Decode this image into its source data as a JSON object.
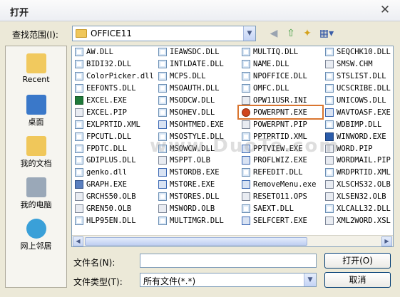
{
  "window": {
    "title": "打开",
    "close_glyph": "✕"
  },
  "lookin": {
    "label": "查找范围(I):",
    "value": "OFFICE11"
  },
  "places": [
    {
      "label": "Recent"
    },
    {
      "label": "桌面"
    },
    {
      "label": "我的文档"
    },
    {
      "label": "我的电脑"
    },
    {
      "label": "网上邻居"
    }
  ],
  "files": {
    "col1": [
      {
        "name": "AW.DLL",
        "icon": "dll"
      },
      {
        "name": "BIDI32.DLL",
        "icon": "dll"
      },
      {
        "name": "ColorPicker.dll",
        "icon": "dll"
      },
      {
        "name": "EEFONTS.DLL",
        "icon": "dll"
      },
      {
        "name": "EXCEL.EXE",
        "icon": "xls"
      },
      {
        "name": "EXCEL.PIP",
        "icon": "olb"
      },
      {
        "name": "EXLPRTID.XML",
        "icon": "dll"
      },
      {
        "name": "FPCUTL.DLL",
        "icon": "dll"
      },
      {
        "name": "FPDTC.DLL",
        "icon": "dll"
      },
      {
        "name": "GDIPLUS.DLL",
        "icon": "dll"
      },
      {
        "name": "genko.dll",
        "icon": "dll"
      },
      {
        "name": "GRAPH.EXE",
        "icon": "app"
      },
      {
        "name": "GRCHS50.OLB",
        "icon": "olb"
      },
      {
        "name": "GREN50.OLB",
        "icon": "olb"
      },
      {
        "name": "HLP95EN.DLL",
        "icon": "dll"
      }
    ],
    "col2": [
      {
        "name": "IEAWSDC.DLL",
        "icon": "dll"
      },
      {
        "name": "INTLDATE.DLL",
        "icon": "dll"
      },
      {
        "name": "MCPS.DLL",
        "icon": "dll"
      },
      {
        "name": "MSOAUTH.DLL",
        "icon": "dll"
      },
      {
        "name": "MSODCW.DLL",
        "icon": "dll"
      },
      {
        "name": "MSOHEV.DLL",
        "icon": "dll"
      },
      {
        "name": "MSOHTMED.EXE",
        "icon": "exe"
      },
      {
        "name": "MSOSTYLE.DLL",
        "icon": "dll"
      },
      {
        "name": "MSOWCW.DLL",
        "icon": "dll"
      },
      {
        "name": "MSPPT.OLB",
        "icon": "olb"
      },
      {
        "name": "MSTORDB.EXE",
        "icon": "exe"
      },
      {
        "name": "MSTORE.EXE",
        "icon": "exe"
      },
      {
        "name": "MSTORES.DLL",
        "icon": "dll"
      },
      {
        "name": "MSWORD.OLB",
        "icon": "olb"
      },
      {
        "name": "MULTIMGR.DLL",
        "icon": "dll"
      }
    ],
    "col3": [
      {
        "name": "MULTIQ.DLL",
        "icon": "dll"
      },
      {
        "name": "NAME.DLL",
        "icon": "dll"
      },
      {
        "name": "NPOFFICE.DLL",
        "icon": "dll"
      },
      {
        "name": "OMFC.DLL",
        "icon": "dll"
      },
      {
        "name": "OPW11USR.INI",
        "icon": "olb"
      },
      {
        "name": "POWERPNT.EXE",
        "icon": "ppt",
        "selected": true
      },
      {
        "name": "POWERPNT.PIP",
        "icon": "olb"
      },
      {
        "name": "PPTPRTID.XML",
        "icon": "dll"
      },
      {
        "name": "PPTVIEW.EXE",
        "icon": "exe"
      },
      {
        "name": "PROFLWIZ.EXE",
        "icon": "exe"
      },
      {
        "name": "REFEDIT.DLL",
        "icon": "dll"
      },
      {
        "name": "RemoveMenu.exe",
        "icon": "exe"
      },
      {
        "name": "RESETO11.OPS",
        "icon": "olb"
      },
      {
        "name": "SAEXT.DLL",
        "icon": "dll"
      },
      {
        "name": "SELFCERT.EXE",
        "icon": "exe"
      }
    ],
    "col4": [
      {
        "name": "SEQCHK10.DLL",
        "icon": "dll"
      },
      {
        "name": "SMSW.CHM",
        "icon": "olb"
      },
      {
        "name": "STSLIST.DLL",
        "icon": "dll"
      },
      {
        "name": "UCSCRIBE.DLL",
        "icon": "dll"
      },
      {
        "name": "UNICOWS.DLL",
        "icon": "dll"
      },
      {
        "name": "WAVTOASF.EXE",
        "icon": "exe"
      },
      {
        "name": "WDBIMP.DLL",
        "icon": "dll"
      },
      {
        "name": "WINWORD.EXE",
        "icon": "doc"
      },
      {
        "name": "WORD.PIP",
        "icon": "olb"
      },
      {
        "name": "WORDMAIL.PIP",
        "icon": "olb"
      },
      {
        "name": "WRDPRTID.XML",
        "icon": "dll"
      },
      {
        "name": "XLSCHS32.OLB",
        "icon": "olb"
      },
      {
        "name": "XLSEN32.OLB",
        "icon": "olb"
      },
      {
        "name": "XLCALL32.DLL",
        "icon": "dll"
      },
      {
        "name": "XML2WORD.XSL",
        "icon": "olb"
      }
    ]
  },
  "filename": {
    "label": "文件名(N):",
    "value": ""
  },
  "filetype": {
    "label": "文件类型(T):",
    "value": "所有文件(*.*)"
  },
  "buttons": {
    "open": "打开(O)",
    "cancel": "取消"
  },
  "watermark": "www.DuoTe.com"
}
